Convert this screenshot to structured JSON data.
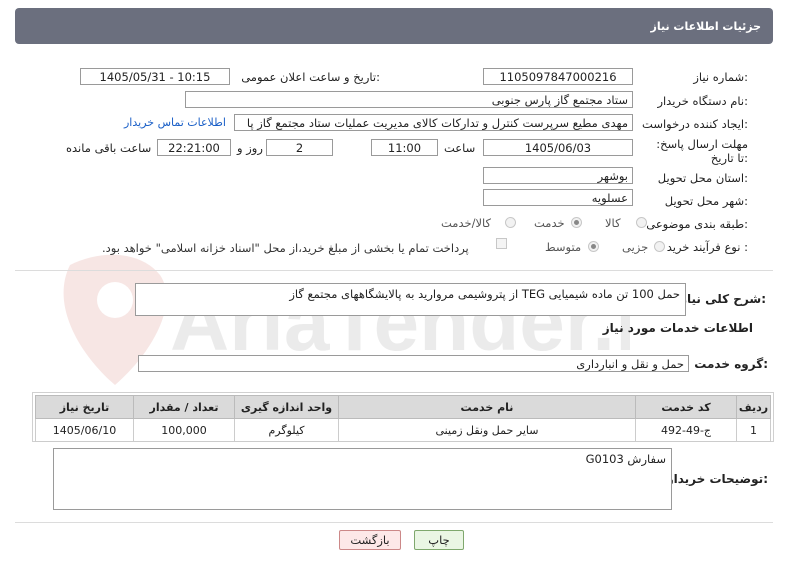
{
  "header": {
    "title": "جزئیات اطلاعات نیاز"
  },
  "fields": {
    "need_number_label": "شماره نیاز:",
    "need_number": "1105097847000216",
    "announce_label": "تاریخ و ساعت اعلان عمومی:",
    "announce_value": "1405/05/31 - 10:15",
    "buyer_org_label": "نام دستگاه خریدار:",
    "buyer_org": "ستاد مجتمع گاز پارس جنوبی",
    "creator_label": "ایجاد کننده درخواست:",
    "creator": "مهدی مطیع سرپرست کنترل و تدارکات کالای مدیریت عملیات ستاد مجتمع گاز پا",
    "contact_link": "اطلاعات تماس خریدار",
    "deadline_label": "مهلت ارسال پاسخ: تا تاریخ:",
    "deadline_date": "1405/06/03",
    "time_label": "ساعت",
    "deadline_time": "11:00",
    "days_value": "2",
    "days_label": "روز و",
    "remaining_time": "22:21:00",
    "remaining_label": "ساعت باقی مانده",
    "province_label": "استان محل تحویل:",
    "province": "بوشهر",
    "city_label": "شهر محل تحویل:",
    "city": "عسلویه",
    "category_label": "طبقه بندی موضوعی:",
    "category_options": [
      "کالا",
      "خدمت",
      "کالا/خدمت"
    ],
    "category_selected": "خدمت",
    "process_label": "نوع فرآیند خرید :",
    "process_options": [
      "جزیی",
      "متوسط"
    ],
    "process_selected": "متوسط",
    "payment_note": "پرداخت تمام یا بخشی از مبلغ خرید،از محل \"اسناد خزانه اسلامی\" خواهد بود."
  },
  "description": {
    "label": "شرح کلی نیاز:",
    "value": "حمل 100 تن ماده شیمیایی TEG از پتروشیمی مروارید به پالایشگاههای مجتمع گاز"
  },
  "services_section": {
    "title": "اطلاعات خدمات مورد نیاز",
    "group_label": "گروه خدمت:",
    "group_value": "حمل و نقل و انبارداری"
  },
  "table": {
    "headers": [
      "ردیف",
      "کد خدمت",
      "نام خدمت",
      "واحد اندازه گیری",
      "تعداد / مقدار",
      "تاریخ نیاز"
    ],
    "rows": [
      [
        "1",
        "ج-49-492",
        "سایر حمل ونقل زمینی",
        "کیلوگرم",
        "100,000",
        "1405/06/10"
      ]
    ]
  },
  "buyer_notes": {
    "label": "توضیحات خریدار:",
    "value": "سفارش G0103"
  },
  "buttons": {
    "print": "چاپ",
    "back": "بازگشت"
  },
  "watermark": {
    "text": "AriaTender.net"
  },
  "colors": {
    "header_bg": "#6b6f7e",
    "link": "#1a5fc7",
    "back_btn_bg": "#fde8e8",
    "print_btn_bg": "#eaf6e4"
  }
}
